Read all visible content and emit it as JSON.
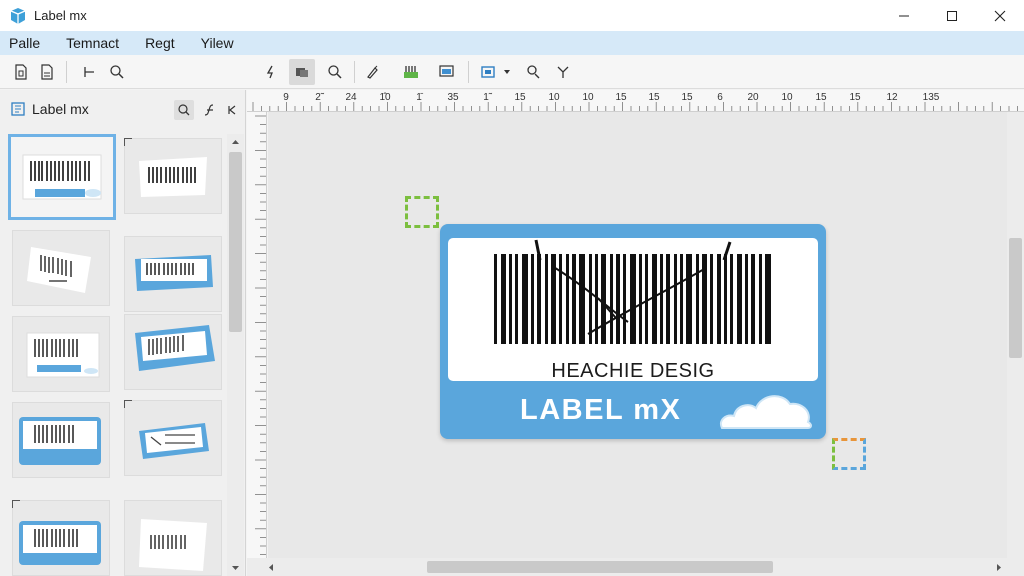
{
  "window": {
    "title": "Label mx"
  },
  "menu": {
    "items": [
      "Palle",
      "Temnact",
      "Regt",
      "Yilew"
    ]
  },
  "panel": {
    "title": "Label mx"
  },
  "ruler": {
    "top": [
      "9",
      "2̃",
      "24",
      "1̂0",
      "1̄",
      "35",
      "1̃",
      "15",
      "10",
      "10",
      "15",
      "15",
      "15",
      "6",
      "20",
      "10",
      "15",
      "15",
      "12",
      "135"
    ]
  },
  "label": {
    "main_text": "HEACHIE DESIG",
    "brand": "LABEL mX"
  },
  "colors": {
    "accent": "#5aa6dc",
    "menubar": "#d6e9f8",
    "handle_green": "#7cbf3f",
    "handle_orange": "#e8953a",
    "handle_blue": "#5aa6dc"
  }
}
